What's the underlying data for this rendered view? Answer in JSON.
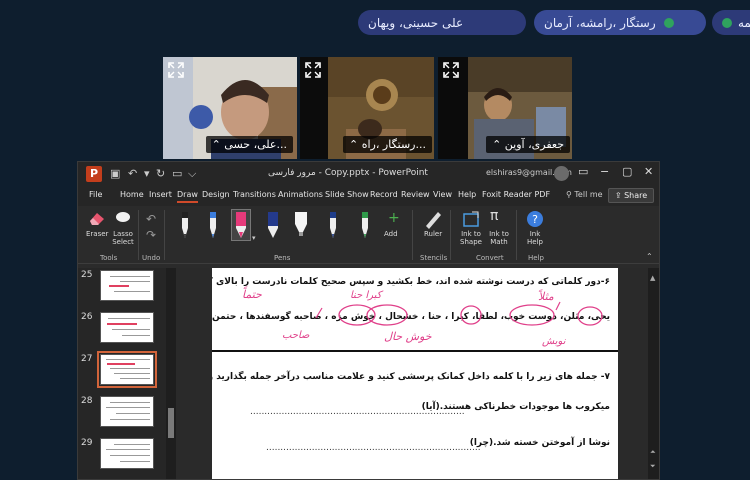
{
  "groups": [
    {
      "label": "طمه"
    },
    {
      "label": "رستگار ،رامشه، آرمان"
    },
    {
      "label": "علی حسینی، ویهان"
    }
  ],
  "participants": [
    {
      "name": "علی، حسی..."
    },
    {
      "name": "رستگار ،راه..."
    },
    {
      "name": "جعفری، آوین"
    }
  ],
  "ppt": {
    "title": "مرور فارسی - Copy.pptx - PowerPoint",
    "email": "elshiras9@gmail.com",
    "menu": [
      "File",
      "Home",
      "Insert",
      "Draw",
      "Design",
      "Transitions",
      "Animations",
      "Slide Show",
      "Record",
      "Review",
      "View",
      "Help",
      "Foxit Reader PDF"
    ],
    "tell_me": "Tell me",
    "share": "Share",
    "ribbon": {
      "eraser": "Eraser",
      "lasso": "Lasso Select",
      "tools": "Tools",
      "undo": "Undo",
      "add": "Add",
      "pens": "Pens",
      "ruler": "Ruler",
      "stencils": "Stencils",
      "ink_to_shape": "Ink to Shape",
      "ink_to_math": "Ink to Math",
      "convert": "Convert",
      "ink_help": "Ink Help",
      "help": "Help"
    },
    "thumbnails": [
      "25",
      "26",
      "27",
      "28",
      "29"
    ],
    "slide": {
      "q6": "۶-دور کلماتی که درست نوشته شده اند، خط بکشید و سپس صحیح کلمات نادرست را بالای کلمه بنویسید.",
      "words": "یحی، مثلن، دوست خوب، لطفا، کبرا ، حنا ، خشحال ، خوش مزه ، صاحبه گوسفندها ، حتمن",
      "hw_1": "کبرا حنا",
      "hw_2": "مثلاً",
      "hw_3": "حتماً",
      "hw_4": "خوش حال",
      "hw_5": "صاحب",
      "hw_6": "نوبش",
      "q7": "۷- جمله های زیر را با کلمه داخل کمانک پرسشی کنید و علامت مناسب درآخر جمله بگذارید و بنویسید.",
      "s1": "میکروب ها موجودات خطرناکی هستند.(آیا)",
      "s2": "نوشا از آموختن خسته شد.(چرا)",
      "dots": "..........................................................................."
    }
  }
}
